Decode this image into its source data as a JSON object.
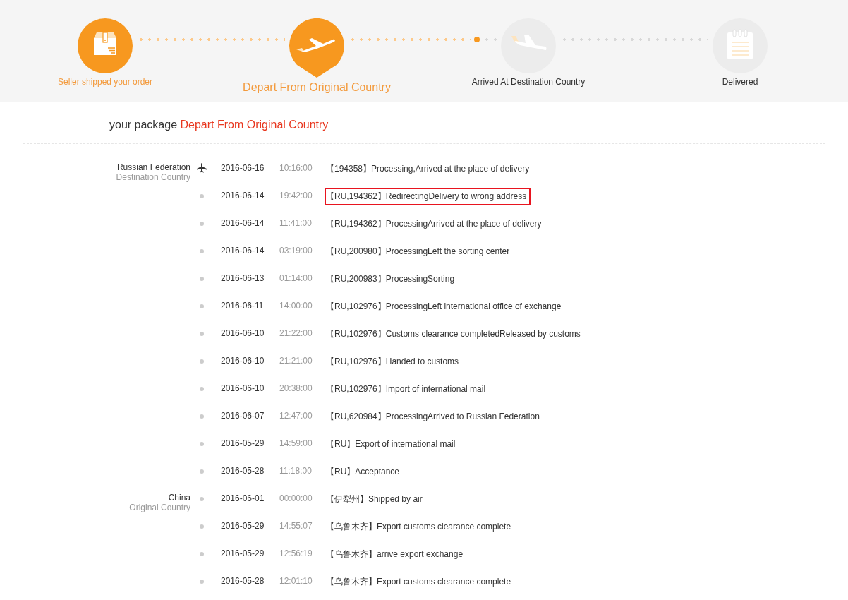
{
  "steps": [
    {
      "label": "Seller shipped your order",
      "completed": true,
      "selected": false
    },
    {
      "label": "Depart From Original Country",
      "completed": true,
      "selected": true
    },
    {
      "label": "Arrived At Destination Country",
      "completed": false,
      "selected": false
    },
    {
      "label": "Delivered",
      "completed": false,
      "selected": false
    }
  ],
  "status": {
    "prefix": "your package",
    "value": "Depart From Original Country"
  },
  "groups": [
    {
      "country": "Russian Federation",
      "role": "Destination Country",
      "events": [
        {
          "kind": "plane",
          "date": "2016-06-16",
          "time": "10:16:00",
          "text": "【194358】Processing,Arrived at the place of delivery",
          "highlighted": false
        },
        {
          "kind": "dot",
          "date": "2016-06-14",
          "time": "19:42:00",
          "text": "【RU,194362】RedirectingDelivery to wrong address",
          "highlighted": true
        },
        {
          "kind": "dot",
          "date": "2016-06-14",
          "time": "11:41:00",
          "text": "【RU,194362】ProcessingArrived at the place of delivery",
          "highlighted": false
        },
        {
          "kind": "dot",
          "date": "2016-06-14",
          "time": "03:19:00",
          "text": "【RU,200980】ProcessingLeft the sorting center",
          "highlighted": false
        },
        {
          "kind": "dot",
          "date": "2016-06-13",
          "time": "01:14:00",
          "text": "【RU,200983】ProcessingSorting",
          "highlighted": false
        },
        {
          "kind": "dot",
          "date": "2016-06-11",
          "time": "14:00:00",
          "text": "【RU,102976】ProcessingLeft international office of exchange",
          "highlighted": false
        },
        {
          "kind": "dot",
          "date": "2016-06-10",
          "time": "21:22:00",
          "text": "【RU,102976】Customs clearance completedReleased by customs",
          "highlighted": false
        },
        {
          "kind": "dot",
          "date": "2016-06-10",
          "time": "21:21:00",
          "text": "【RU,102976】Handed to customs",
          "highlighted": false
        },
        {
          "kind": "dot",
          "date": "2016-06-10",
          "time": "20:38:00",
          "text": "【RU,102976】Import of international mail",
          "highlighted": false
        },
        {
          "kind": "dot",
          "date": "2016-06-07",
          "time": "12:47:00",
          "text": "【RU,620984】ProcessingArrived to Russian Federation",
          "highlighted": false
        },
        {
          "kind": "dot",
          "date": "2016-05-29",
          "time": "14:59:00",
          "text": "【RU】Export of international mail",
          "highlighted": false
        },
        {
          "kind": "dot",
          "date": "2016-05-28",
          "time": "11:18:00",
          "text": "【RU】Acceptance",
          "highlighted": false
        }
      ]
    },
    {
      "country": "China",
      "role": "Original Country",
      "events": [
        {
          "kind": "dot",
          "date": "2016-06-01",
          "time": "00:00:00",
          "text": "【伊犁州】Shipped by air",
          "highlighted": false
        },
        {
          "kind": "dot",
          "date": "2016-05-29",
          "time": "14:55:07",
          "text": "【乌鲁木齐】Export customs clearance complete",
          "highlighted": false
        },
        {
          "kind": "dot",
          "date": "2016-05-29",
          "time": "12:56:19",
          "text": "【乌鲁木齐】arrive export exchange",
          "highlighted": false
        },
        {
          "kind": "dot",
          "date": "2016-05-28",
          "time": "12:01:10",
          "text": "【乌鲁木齐】Export customs clearance complete",
          "highlighted": false
        }
      ]
    }
  ]
}
